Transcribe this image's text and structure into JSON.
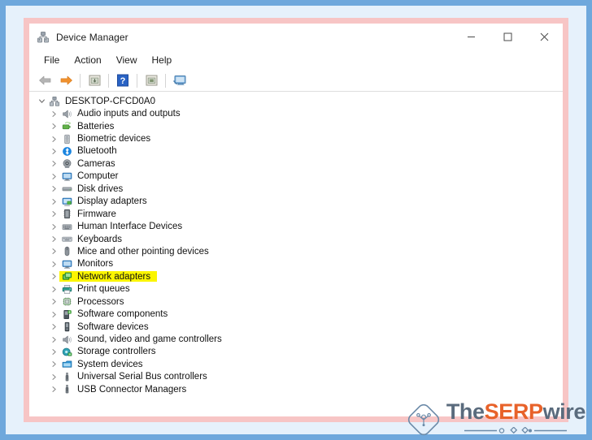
{
  "theme": {
    "outer_border_color": "#6fa8dc",
    "backdrop_color": "#e6f1fb",
    "frame_color": "#f7c5c5",
    "window_bg": "#ffffff",
    "highlight_color": "#fbf500",
    "accent_orange": "#e8622a",
    "watermark_gray": "#5a6b7d"
  },
  "window": {
    "title": "Device Manager",
    "title_icon": "device-manager-icon",
    "controls": {
      "minimize": "–",
      "maximize": "□",
      "close": "✕"
    }
  },
  "menu": {
    "items": [
      {
        "label": "File"
      },
      {
        "label": "Action"
      },
      {
        "label": "View"
      },
      {
        "label": "Help"
      }
    ]
  },
  "toolbar": {
    "buttons": [
      {
        "name": "back-arrow-icon",
        "label": "Back"
      },
      {
        "name": "forward-arrow-icon",
        "label": "Forward"
      },
      {
        "name": "properties-icon",
        "label": "Properties"
      },
      {
        "name": "help-icon",
        "label": "Help"
      },
      {
        "name": "scan-hardware-icon",
        "label": "Scan for hardware changes"
      },
      {
        "name": "show-devices-icon",
        "label": "Show hidden devices"
      }
    ]
  },
  "tree": {
    "root": {
      "label": "DESKTOP-CFCD0A0",
      "icon": "computer-root-icon",
      "expanded": true
    },
    "items": [
      {
        "label": "Audio inputs and outputs",
        "icon": "speaker-icon",
        "highlighted": false
      },
      {
        "label": "Batteries",
        "icon": "battery-icon",
        "highlighted": false
      },
      {
        "label": "Biometric devices",
        "icon": "biometric-icon",
        "highlighted": false
      },
      {
        "label": "Bluetooth",
        "icon": "bluetooth-icon",
        "highlighted": false
      },
      {
        "label": "Cameras",
        "icon": "camera-icon",
        "highlighted": false
      },
      {
        "label": "Computer",
        "icon": "monitor-icon",
        "highlighted": false
      },
      {
        "label": "Disk drives",
        "icon": "disk-drive-icon",
        "highlighted": false
      },
      {
        "label": "Display adapters",
        "icon": "display-adapter-icon",
        "highlighted": false
      },
      {
        "label": "Firmware",
        "icon": "firmware-icon",
        "highlighted": false
      },
      {
        "label": "Human Interface Devices",
        "icon": "hid-icon",
        "highlighted": false
      },
      {
        "label": "Keyboards",
        "icon": "keyboard-icon",
        "highlighted": false
      },
      {
        "label": "Mice and other pointing devices",
        "icon": "mouse-icon",
        "highlighted": false
      },
      {
        "label": "Monitors",
        "icon": "monitor-icon",
        "highlighted": false
      },
      {
        "label": "Network adapters",
        "icon": "network-adapter-icon",
        "highlighted": true
      },
      {
        "label": "Print queues",
        "icon": "printer-icon",
        "highlighted": false
      },
      {
        "label": "Processors",
        "icon": "processor-icon",
        "highlighted": false
      },
      {
        "label": "Software components",
        "icon": "software-component-icon",
        "highlighted": false
      },
      {
        "label": "Software devices",
        "icon": "software-device-icon",
        "highlighted": false
      },
      {
        "label": "Sound, video and game controllers",
        "icon": "speaker-icon",
        "highlighted": false
      },
      {
        "label": "Storage controllers",
        "icon": "storage-controller-icon",
        "highlighted": false
      },
      {
        "label": "System devices",
        "icon": "system-device-icon",
        "highlighted": false
      },
      {
        "label": "Universal Serial Bus controllers",
        "icon": "usb-icon",
        "highlighted": false
      },
      {
        "label": "USB Connector Managers",
        "icon": "usb-icon",
        "highlighted": false
      }
    ]
  },
  "watermark": {
    "text_the": "The",
    "text_serp": "SERP",
    "text_wire": "wire",
    "logo": "serpwire-diamond-logo"
  }
}
